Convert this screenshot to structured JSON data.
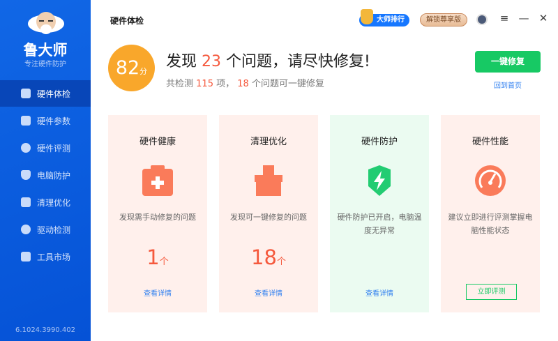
{
  "sidebar": {
    "brand": "鲁大师",
    "slogan": "专注硬件防护",
    "version": "6.1024.3990.402",
    "items": [
      {
        "label": "硬件体检"
      },
      {
        "label": "硬件参数"
      },
      {
        "label": "硬件评测"
      },
      {
        "label": "电脑防护"
      },
      {
        "label": "清理优化"
      },
      {
        "label": "驱动检测"
      },
      {
        "label": "工具市场"
      }
    ]
  },
  "header": {
    "title": "硬件体检",
    "rank_label": "大师排行",
    "vip_label": "解锁尊享版"
  },
  "summary": {
    "score": "82",
    "score_unit": "分",
    "headline_pre": "发现",
    "issues": "23",
    "headline_post": "个问题，请尽快修复!",
    "sub_pre": "共检测",
    "checked": "115",
    "sub_mid": "项，",
    "fixable": "18",
    "sub_post": "个问题可一键修复",
    "fix_button": "一键修复",
    "home_link": "回到首页"
  },
  "cards": [
    {
      "title": "硬件健康",
      "desc": "发现需手动修复的问题",
      "count": "1",
      "unit": "个",
      "action": "查看详情"
    },
    {
      "title": "清理优化",
      "desc": "发现可一键修复的问题",
      "count": "18",
      "unit": "个",
      "action": "查看详情"
    },
    {
      "title": "硬件防护",
      "desc": "硬件防护已开启，电脑温度无异常",
      "action": "查看详情"
    },
    {
      "title": "硬件性能",
      "desc": "建议立即进行评测掌握电脑性能状态",
      "action": "立即评测"
    }
  ],
  "colors": {
    "accent": "#0a5ce0",
    "danger": "#f5593d",
    "success": "#17c964",
    "score": "#f9a72b"
  }
}
